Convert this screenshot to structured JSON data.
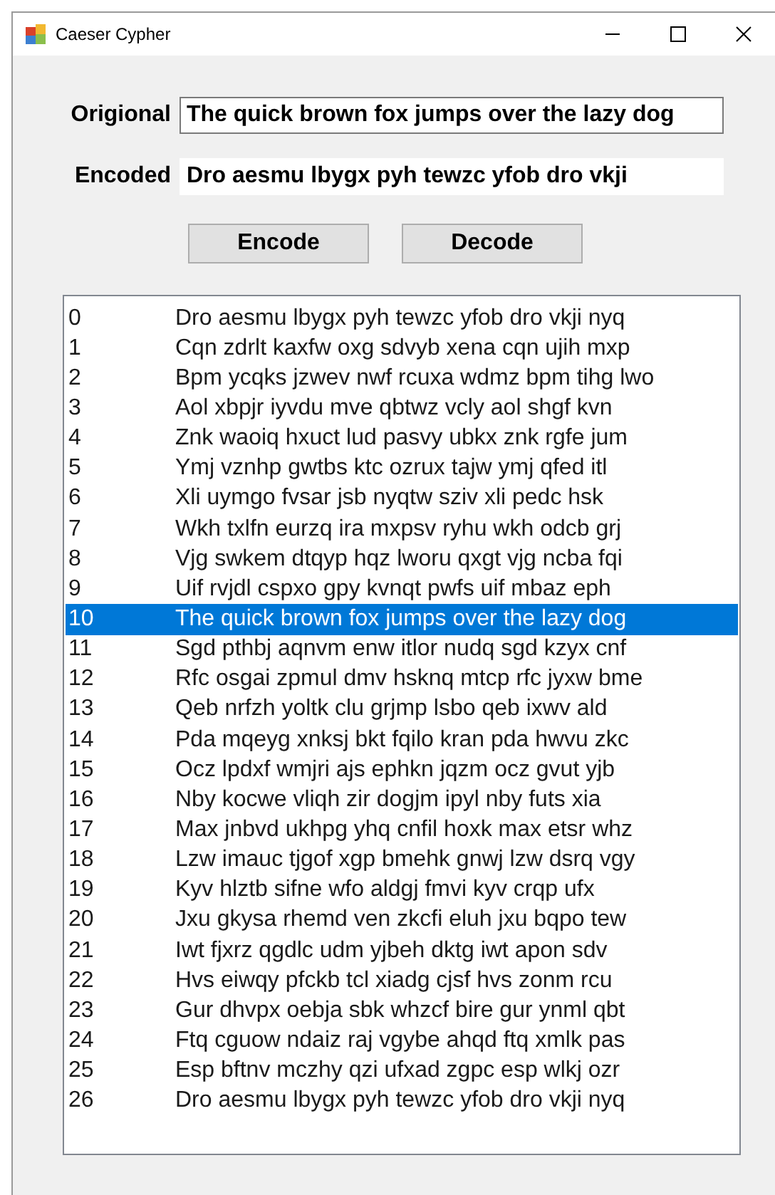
{
  "window": {
    "title": "Caeser Cypher"
  },
  "fields": [
    {
      "label": "Origional",
      "value": "The quick brown fox jumps over the lazy dog",
      "bordered": true
    },
    {
      "label": "Encoded",
      "value": "Dro aesmu lbygx pyh tewzc yfob dro vkji",
      "bordered": false
    }
  ],
  "buttons": [
    "Encode",
    "Decode"
  ],
  "list": [
    {
      "index": "0",
      "text": "Dro aesmu lbygx pyh tewzc yfob dro vkji nyq",
      "selected": false
    },
    {
      "index": "1",
      "text": "Cqn zdrlt kaxfw oxg sdvyb xena cqn ujih mxp",
      "selected": false
    },
    {
      "index": "2",
      "text": "Bpm ycqks jzwev nwf rcuxa wdmz bpm tihg lwo",
      "selected": false
    },
    {
      "index": "3",
      "text": "Aol xbpjr iyvdu mve qbtwz vcly aol shgf kvn",
      "selected": false
    },
    {
      "index": "4",
      "text": "Znk waoiq hxuct lud pasvy ubkx znk rgfe jum",
      "selected": false
    },
    {
      "index": "5",
      "text": "Ymj vznhp gwtbs ktc ozrux tajw ymj qfed itl",
      "selected": false
    },
    {
      "index": "6",
      "text": "Xli uymgo fvsar jsb nyqtw sziv xli pedc hsk",
      "selected": false
    },
    {
      "index": "7",
      "text": "Wkh txlfn eurzq ira mxpsv ryhu wkh odcb grj",
      "selected": false
    },
    {
      "index": "8",
      "text": "Vjg swkem dtqyp hqz lworu qxgt vjg ncba fqi",
      "selected": false
    },
    {
      "index": "9",
      "text": "Uif rvjdl cspxo gpy kvnqt pwfs uif mbaz eph",
      "selected": false
    },
    {
      "index": "10",
      "text": "The quick brown fox jumps over the lazy dog",
      "selected": true
    },
    {
      "index": "11",
      "text": "Sgd pthbj aqnvm enw itlor nudq sgd kzyx cnf",
      "selected": false
    },
    {
      "index": "12",
      "text": "Rfc osgai zpmul dmv hsknq mtcp rfc jyxw bme",
      "selected": false
    },
    {
      "index": "13",
      "text": "Qeb nrfzh yoltk clu grjmp lsbo qeb ixwv ald",
      "selected": false
    },
    {
      "index": "14",
      "text": "Pda mqeyg xnksj bkt fqilo kran pda hwvu zkc",
      "selected": false
    },
    {
      "index": "15",
      "text": "Ocz lpdxf wmjri ajs ephkn jqzm ocz gvut yjb",
      "selected": false
    },
    {
      "index": "16",
      "text": "Nby kocwe vliqh zir dogjm ipyl nby futs xia",
      "selected": false
    },
    {
      "index": "17",
      "text": "Max jnbvd ukhpg yhq cnfil hoxk max etsr whz",
      "selected": false
    },
    {
      "index": "18",
      "text": "Lzw imauc tjgof xgp bmehk gnwj lzw dsrq vgy",
      "selected": false
    },
    {
      "index": "19",
      "text": "Kyv hlztb sifne wfo aldgj fmvi kyv crqp ufx",
      "selected": false
    },
    {
      "index": "20",
      "text": "Jxu gkysa rhemd ven zkcfi eluh jxu bqpo tew",
      "selected": false
    },
    {
      "index": "21",
      "text": "Iwt fjxrz qgdlc udm yjbeh dktg iwt apon sdv",
      "selected": false
    },
    {
      "index": "22",
      "text": "Hvs eiwqy pfckb tcl xiadg cjsf hvs zonm rcu",
      "selected": false
    },
    {
      "index": "23",
      "text": "Gur dhvpx oebja sbk whzcf bire gur ynml qbt",
      "selected": false
    },
    {
      "index": "24",
      "text": "Ftq cguow ndaiz raj vgybe ahqd ftq xmlk pas",
      "selected": false
    },
    {
      "index": "25",
      "text": "Esp bftnv mczhy qzi ufxad zgpc esp wlkj ozr",
      "selected": false
    },
    {
      "index": "26",
      "text": "Dro aesmu lbygx pyh tewzc yfob dro vkji nyq",
      "selected": false
    }
  ]
}
